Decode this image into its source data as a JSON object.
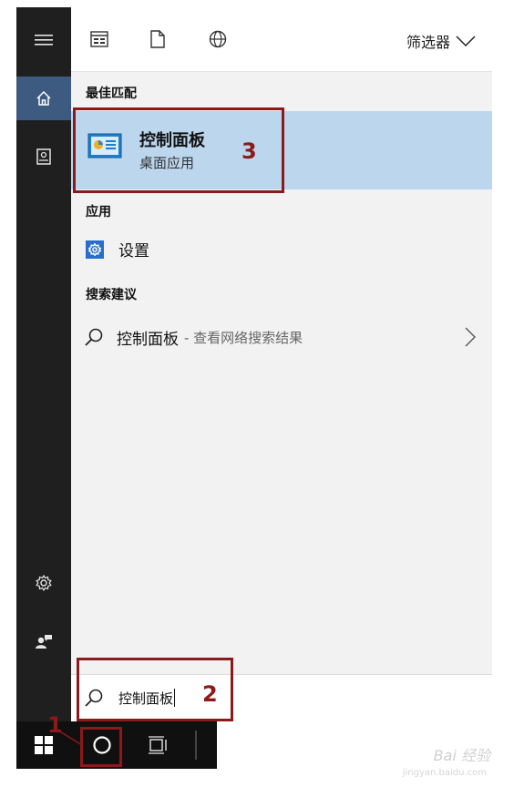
{
  "colors": {
    "rail": "#1f1f1f",
    "rail_active": "#3d5a80",
    "highlight": "#bcd6ee",
    "annotation": "#8b1a1a",
    "gear_accent": "#2a6dcc"
  },
  "rail": {
    "icons": [
      "hamburger-icon",
      "home-icon",
      "notebook-icon",
      "settings-icon",
      "feedback-icon"
    ]
  },
  "topbar": {
    "icons": [
      "apps-icon",
      "document-icon",
      "web-icon"
    ],
    "filter_label": "筛选器"
  },
  "best_match": {
    "heading": "最佳匹配",
    "title": "控制面板",
    "subtitle": "桌面应用"
  },
  "apps": {
    "heading": "应用",
    "settings_label": "设置"
  },
  "suggestions": {
    "heading": "搜索建议",
    "term": "控制面板",
    "hint": "- 查看网络搜索结果"
  },
  "search": {
    "value": "控制面板"
  },
  "annotations": {
    "one": "1",
    "two": "2",
    "three": "3"
  },
  "watermark": {
    "text": "Bai 经验",
    "sub": "jingyan.baidu.com"
  }
}
